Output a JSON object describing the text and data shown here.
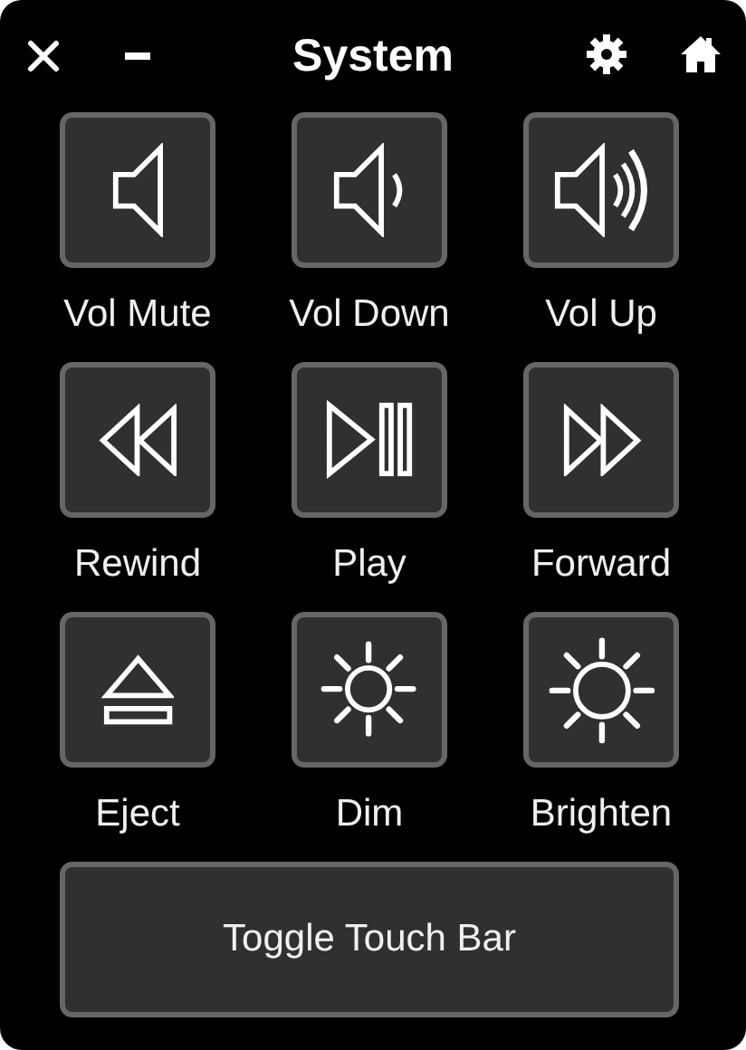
{
  "header": {
    "title": "System"
  },
  "buttons": [
    {
      "kind": "vol-mute",
      "label": "Vol Mute"
    },
    {
      "kind": "vol-down",
      "label": "Vol Down"
    },
    {
      "kind": "vol-up",
      "label": "Vol Up"
    },
    {
      "kind": "rewind",
      "label": "Rewind"
    },
    {
      "kind": "play",
      "label": "Play"
    },
    {
      "kind": "forward",
      "label": "Forward"
    },
    {
      "kind": "eject",
      "label": "Eject"
    },
    {
      "kind": "dim",
      "label": "Dim"
    },
    {
      "kind": "brighten",
      "label": "Brighten"
    }
  ],
  "wide_button": {
    "label": "Toggle Touch Bar"
  }
}
